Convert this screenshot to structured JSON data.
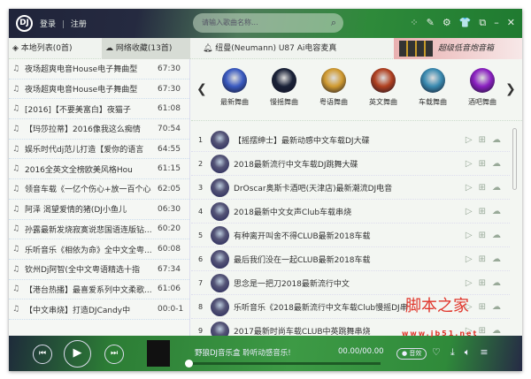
{
  "header": {
    "logo": "DJ",
    "login": "登录",
    "separator": "|",
    "register": "注册",
    "search_placeholder": "请输入歌曲名称...",
    "icons": [
      "apps-icon",
      "feedback-icon",
      "settings-icon",
      "skin-icon",
      "mini-mode-icon",
      "minimize-icon",
      "close-icon"
    ]
  },
  "tabs": {
    "local": "本地列表(0首)",
    "network": "网络收藏(13首)",
    "notice": "纽曼(Neumann) U87 Ai电容麦真",
    "ad": "超级低音炮音箱"
  },
  "left_list": [
    {
      "name": "夜场超爽电音House电子舞曲型",
      "time": "67:30"
    },
    {
      "name": "夜场超爽电音House电子舞曲型",
      "time": "67:30"
    },
    {
      "name": "[2016]【不要美富白】夜猫子",
      "time": "61:08"
    },
    {
      "name": "【玛莎拉蒂】2016像我这么痴情",
      "time": "70:54"
    },
    {
      "name": "娱乐时代dj范儿打造【爱你的语言",
      "time": "64:55"
    },
    {
      "name": "2016全英文全榜欧美风格Hou",
      "time": "61:15"
    },
    {
      "name": "领音车载《一亿个伤心+放一百个心",
      "time": "62:05"
    },
    {
      "name": "阿泽 渴望爱情的猪(DJ小鱼儿",
      "time": "06:30"
    },
    {
      "name": "孙露最新发烧寂寞说悲国语连版钻...",
      "time": "60:20"
    },
    {
      "name": "乐听音乐《相依为命》全中文全粤...",
      "time": "60:08"
    },
    {
      "name": "钦州Dj阿智(全中文粤语精选十指",
      "time": "67:34"
    },
    {
      "name": "【港台热播】最喜爱系列中文柔歌...",
      "time": "61:06"
    },
    {
      "name": "【中文串烧】打造DJCandy中",
      "time": "00:0-1"
    }
  ],
  "categories": [
    {
      "label": "最新舞曲",
      "color": "#3a5ac0"
    },
    {
      "label": "慢摇舞曲",
      "color": "#1a2238"
    },
    {
      "label": "粤语舞曲",
      "color": "#d09a30"
    },
    {
      "label": "英文舞曲",
      "color": "#b04020"
    },
    {
      "label": "车载舞曲",
      "color": "#3a8ab0"
    },
    {
      "label": "酒吧舞曲",
      "color": "#8a20c0"
    }
  ],
  "songs": [
    {
      "no": "1",
      "title": "【摇摆绅士】最新动感中文车载DJ大碟"
    },
    {
      "no": "2",
      "title": "2018最新流行中文车载DJ跳舞大碟"
    },
    {
      "no": "3",
      "title": "DrOscar奥斯卡酒吧(天津店)最新潮流DJ电音"
    },
    {
      "no": "4",
      "title": "2018最新中文女声Club车载串烧"
    },
    {
      "no": "5",
      "title": "有种离开叫舍不得CLUB最新2018车载"
    },
    {
      "no": "6",
      "title": "最后我们没在一起CLUB最新2018车载"
    },
    {
      "no": "7",
      "title": "思念是一把刀2018最新流行中文"
    },
    {
      "no": "8",
      "title": "乐听音乐《2018最新流行中文车载Club慢摇DJ串"
    },
    {
      "no": "9",
      "title": "2017最新时尚车载CLUB中英跳舞串烧"
    }
  ],
  "player": {
    "title": "野狼DJ音乐盒 聆听动感音乐!",
    "time": "00.00/00.00",
    "sound_label": "音效",
    "progress": 0
  },
  "watermark": {
    "text": "脚本之家",
    "url": "www.jb51.net"
  }
}
